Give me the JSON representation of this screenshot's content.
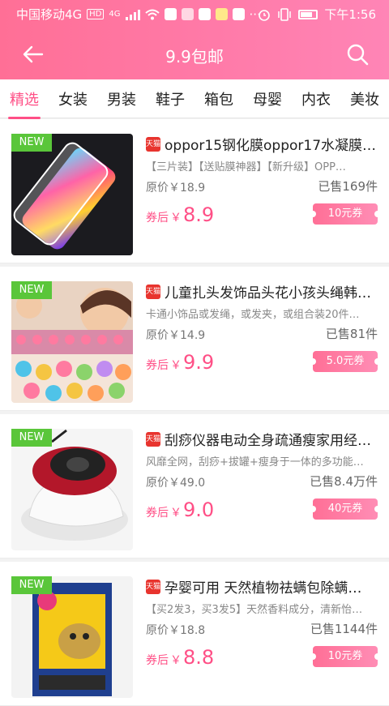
{
  "status_bar": {
    "carrier": "中国移动4G",
    "hd": "HD",
    "network": "4G",
    "time": "下午1:56",
    "more": "···"
  },
  "nav": {
    "title": "9.9包邮"
  },
  "tabs": [
    "精选",
    "女装",
    "男装",
    "鞋子",
    "箱包",
    "母婴",
    "内衣",
    "美妆"
  ],
  "products": [
    {
      "badge": "NEW",
      "tag": "天猫",
      "title": "oppor15钢化膜oppor17水凝膜fi…",
      "desc": "【三片装】【送贴膜神器】【新升级】OPP…",
      "original_price": "原价￥18.9",
      "sold": "已售169件",
      "after_label": "券后",
      "currency": "￥",
      "after_price": "8.9",
      "coupon": "10元券"
    },
    {
      "badge": "NEW",
      "tag": "天猫",
      "title": "儿童扎头发饰品头花小孩头绳韩…",
      "desc": "卡通小饰品或发绳，或发夹，或组合装20件…",
      "original_price": "原价￥14.9",
      "sold": "已售81件",
      "after_label": "券后",
      "currency": "￥",
      "after_price": "9.9",
      "coupon": "5.0元券"
    },
    {
      "badge": "NEW",
      "tag": "天猫",
      "title": "刮痧仪器电动全身疏通瘦家用经…",
      "desc": "风靡全网，刮痧+拔罐+瘦身于一体的多功能…",
      "original_price": "原价￥49.0",
      "sold": "已售8.4万件",
      "after_label": "券后",
      "currency": "￥",
      "after_price": "9.0",
      "coupon": "40元券"
    },
    {
      "badge": "NEW",
      "tag": "天猫",
      "title": "孕婴可用 天然植物祛螨包除螨…",
      "desc": "【买2发3，买3发5】天然香料成分，清新怡…",
      "original_price": "原价￥18.8",
      "sold": "已售1144件",
      "after_label": "券后",
      "currency": "￥",
      "after_price": "8.8",
      "coupon": "10元券"
    }
  ],
  "colors": {
    "accent": "#ff4f86",
    "new_badge": "#5ac63a",
    "tmall": "#e8342e"
  }
}
